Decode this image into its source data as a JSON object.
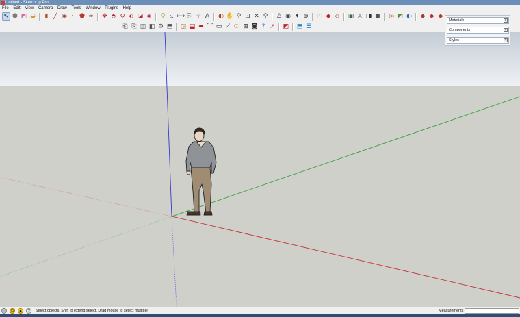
{
  "window": {
    "title": "Untitled - SketchUp Pro"
  },
  "menu": [
    "File",
    "Edit",
    "View",
    "Camera",
    "Draw",
    "Tools",
    "Window",
    "Plugins",
    "Help"
  ],
  "toolbar_row1": [
    {
      "name": "select-icon",
      "glyph": "↖",
      "color": "#222222",
      "selected": true
    },
    {
      "name": "make-component-icon",
      "glyph": "⬢",
      "color": "#7c7c7c"
    },
    {
      "name": "eraser-icon",
      "glyph": "◩",
      "color": "#d06ca0"
    },
    {
      "name": "paint-bucket-icon",
      "glyph": "◒",
      "color": "#c9a13a"
    },
    {
      "sep": true
    },
    {
      "name": "rectangle-icon",
      "glyph": "▮",
      "color": "#b44a2a"
    },
    {
      "name": "line-icon",
      "glyph": "╱",
      "color": "#b33a2a"
    },
    {
      "name": "circle-icon",
      "glyph": "◉",
      "color": "#a8503a"
    },
    {
      "name": "arc-icon",
      "glyph": "◜",
      "color": "#b33a2a"
    },
    {
      "name": "polygon-icon",
      "glyph": "⬟",
      "color": "#b33a2a"
    },
    {
      "name": "freehand-icon",
      "glyph": "≈",
      "color": "#b33a2a"
    },
    {
      "sep": true
    },
    {
      "name": "move-icon",
      "glyph": "✥",
      "color": "#c0202a"
    },
    {
      "name": "push-pull-icon",
      "glyph": "⬘",
      "color": "#c0202a"
    },
    {
      "name": "rotate-icon",
      "glyph": "↻",
      "color": "#c0202a"
    },
    {
      "name": "follow-me-icon",
      "glyph": "⬖",
      "color": "#c0202a"
    },
    {
      "name": "scale-icon",
      "glyph": "◪",
      "color": "#c0202a"
    },
    {
      "name": "offset-icon",
      "glyph": "◈",
      "color": "#c0202a"
    },
    {
      "sep": true
    },
    {
      "name": "tape-measure-icon",
      "glyph": "⚲",
      "color": "#b0861e"
    },
    {
      "name": "protractor-icon",
      "glyph": "⦣",
      "color": "#5a5a5a"
    },
    {
      "name": "dimensions-icon",
      "glyph": "⟷",
      "color": "#5a5a5a"
    },
    {
      "name": "text-icon",
      "glyph": "⎘",
      "color": "#4a4a4a"
    },
    {
      "name": "axes-icon",
      "glyph": "⊹",
      "color": "#444444"
    },
    {
      "name": "3d-text-icon",
      "glyph": "A",
      "color": "#444444"
    },
    {
      "sep": true
    },
    {
      "name": "orbit-icon",
      "glyph": "◐",
      "color": "#b33a2a"
    },
    {
      "name": "pan-icon",
      "glyph": "✋",
      "color": "#7a5a3a"
    },
    {
      "name": "zoom-icon",
      "glyph": "⚲",
      "color": "#3a3a3a"
    },
    {
      "name": "zoom-window-icon",
      "glyph": "⊡",
      "color": "#3a3a3a"
    },
    {
      "name": "zoom-extents-icon",
      "glyph": "✕",
      "color": "#3a3a3a"
    },
    {
      "name": "previous-view-icon",
      "glyph": "⚲",
      "color": "#3a3a3a"
    },
    {
      "sep": true
    },
    {
      "name": "position-camera-icon",
      "glyph": "♙",
      "color": "#3a3a3a"
    },
    {
      "name": "look-around-icon",
      "glyph": "◉",
      "color": "#3a3a3a"
    },
    {
      "name": "walk-icon",
      "glyph": "⏴",
      "color": "#3a3a3a"
    },
    {
      "name": "section-plane-icon",
      "glyph": "⊕",
      "color": "#3a3a3a"
    },
    {
      "sep": true
    },
    {
      "name": "get-models-icon",
      "glyph": "◰",
      "color": "#7a7a7a"
    },
    {
      "name": "share-model-icon",
      "glyph": "◆",
      "color": "#c0202a"
    },
    {
      "name": "share-component-icon",
      "glyph": "◇",
      "color": "#c0202a"
    },
    {
      "sep": true
    },
    {
      "name": "xray-icon",
      "glyph": "▣",
      "color": "#3a6a3a"
    },
    {
      "name": "wireframe-icon",
      "glyph": "◬",
      "color": "#555555"
    },
    {
      "name": "hidden-line-icon",
      "glyph": "◨",
      "color": "#333333"
    },
    {
      "name": "shaded-icon",
      "glyph": "◼",
      "color": "#555555"
    },
    {
      "sep": true
    },
    {
      "name": "add-location-icon",
      "glyph": "◎",
      "color": "#b33a2a"
    },
    {
      "name": "toggle-terrain-icon",
      "glyph": "◩",
      "color": "#5a8a3a"
    },
    {
      "name": "photo-textures-icon",
      "glyph": "◐",
      "color": "#2a6aaa"
    },
    {
      "sep": true
    },
    {
      "name": "component-options-icon",
      "glyph": "◆",
      "color": "#b33a2a"
    },
    {
      "name": "component-attributes-icon",
      "glyph": "◆",
      "color": "#b33a2a"
    },
    {
      "name": "generate-report-icon",
      "glyph": "◆",
      "color": "#b33a2a"
    }
  ],
  "toolbar_row2": [
    {
      "name": "front-view-icon",
      "glyph": "⎗",
      "color": "#555555"
    },
    {
      "name": "back-view-icon",
      "glyph": "⎘",
      "color": "#555555"
    },
    {
      "name": "top-view-icon",
      "glyph": "◫",
      "color": "#555555"
    },
    {
      "name": "right-view-icon",
      "glyph": "◧",
      "color": "#555555"
    },
    {
      "name": "left-view-icon",
      "glyph": "⚙",
      "color": "#555555"
    },
    {
      "name": "iso-view-icon",
      "glyph": "⬒",
      "color": "#555555"
    },
    {
      "sep": true
    },
    {
      "name": "sandbox-from-contours-icon",
      "glyph": "◲",
      "color": "#b36a2a"
    },
    {
      "name": "sandbox-stamp-icon",
      "glyph": "⬓",
      "color": "#c0202a"
    },
    {
      "name": "sandbox-smoove-icon",
      "glyph": "⬌",
      "color": "#c0202a"
    },
    {
      "name": "sandbox-drape-icon",
      "glyph": "⌒",
      "color": "#333333"
    },
    {
      "name": "sandbox-add-detail-icon",
      "glyph": "▭",
      "color": "#333333"
    },
    {
      "name": "sandbox-flip-edge-icon",
      "glyph": "⟋",
      "color": "#333333"
    },
    {
      "name": "dynamic-component-icon",
      "glyph": "⬭",
      "color": "#b36a2a"
    },
    {
      "name": "solid-tools-icon",
      "glyph": "⊞",
      "color": "#333333"
    },
    {
      "name": "intersect-icon",
      "glyph": "◙",
      "color": "#333333"
    },
    {
      "name": "help-icon",
      "glyph": "?",
      "color": "#2a6acc"
    },
    {
      "name": "interact-icon",
      "glyph": "↗",
      "color": "#c0202a"
    },
    {
      "sep": true
    },
    {
      "name": "layers-icon",
      "glyph": "◩",
      "color": "#c0202a"
    },
    {
      "sep": true
    },
    {
      "name": "scenes-icon",
      "glyph": "⬒",
      "color": "#2a8acc"
    },
    {
      "name": "outliner-icon",
      "glyph": "☰",
      "color": "#2a8acc"
    }
  ],
  "tray": {
    "panels": [
      {
        "name": "materials",
        "label": "Materials"
      },
      {
        "name": "components",
        "label": "Components"
      },
      {
        "name": "styles",
        "label": "Styles"
      }
    ],
    "close_glyph": "×"
  },
  "viewport": {
    "sky_color": "#d9dee4",
    "ground_color": "#cfd0ca",
    "axis_colors": {
      "red": "#c4333a",
      "green": "#3aa13a",
      "blue": "#3a3acc"
    }
  },
  "statusbar": {
    "text": "Select objects. Shift to extend select. Drag mouse to select multiple.",
    "measurements_label": "Measurements",
    "measurements_value": ""
  }
}
